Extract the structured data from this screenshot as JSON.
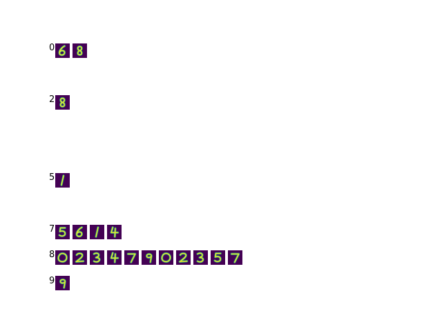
{
  "colors": {
    "tile_background": "#440154",
    "stroke_outer": "#21918c",
    "stroke_mid": "#5ec962",
    "stroke_core": "#fde725"
  },
  "rows": [
    {
      "label": "0",
      "digits": [
        "6",
        "8"
      ]
    },
    {
      "label": "2",
      "digits": [
        "8"
      ]
    },
    {
      "label": "5",
      "digits": [
        "1"
      ]
    },
    {
      "label": "7",
      "digits": [
        "5",
        "6",
        "1",
        "4"
      ]
    },
    {
      "label": "8",
      "digits": [
        "0",
        "2",
        "3",
        "4",
        "7",
        "9",
        "0",
        "2",
        "3",
        "5",
        "7"
      ]
    },
    {
      "label": "9",
      "digits": [
        "9"
      ]
    }
  ]
}
